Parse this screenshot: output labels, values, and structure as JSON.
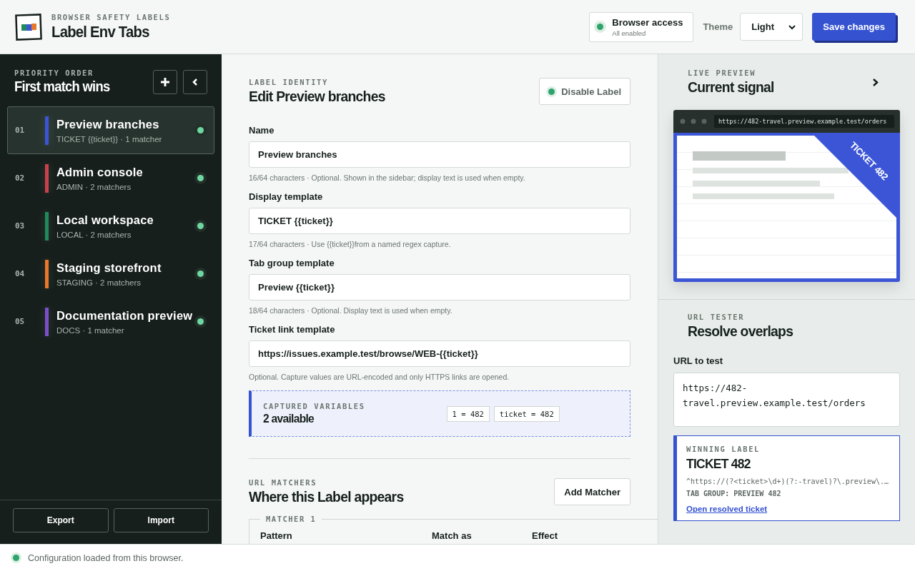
{
  "app": {
    "eyebrow": "BROWSER SAFETY LABELS",
    "title": "Label Env Tabs"
  },
  "access": {
    "label": "Browser access",
    "detail": "All enabled",
    "on": true
  },
  "theme": {
    "label": "Theme",
    "value": "Light"
  },
  "save_button": "Save changes",
  "sidebar": {
    "eyebrow": "PRIORITY ORDER",
    "title": "First match wins",
    "labels": [
      {
        "index": "01",
        "name": "Preview branches",
        "detail": "TICKET {{ticket}} · 1 matcher",
        "color": "#3b55d6",
        "selected": true,
        "enabled": true
      },
      {
        "index": "02",
        "name": "Admin console",
        "detail": "ADMIN · 2 matchers",
        "color": "#c8414b",
        "selected": false,
        "enabled": true
      },
      {
        "index": "03",
        "name": "Local workspace",
        "detail": "LOCAL · 2 matchers",
        "color": "#1f8a5b",
        "selected": false,
        "enabled": true
      },
      {
        "index": "04",
        "name": "Staging storefront",
        "detail": "STAGING · 2 matchers",
        "color": "#e8792a",
        "selected": false,
        "enabled": true
      },
      {
        "index": "05",
        "name": "Documentation preview",
        "detail": "DOCS · 1 matcher",
        "color": "#7a4fc9",
        "selected": false,
        "enabled": true
      }
    ],
    "footer_buttons": [
      "Export",
      "Import"
    ]
  },
  "editor": {
    "eyebrow": "LABEL IDENTITY",
    "title": "Edit Preview branches",
    "disable_button": "Disable Label",
    "fields": [
      {
        "label": "Name",
        "value": "Preview branches",
        "hint": "16/64 characters · Optional. Shown in the sidebar; display text is used when empty."
      },
      {
        "label": "Display template",
        "value": "TICKET {{ticket}}",
        "hint": "17/64 characters · Use {{ticket}}from a named regex capture."
      },
      {
        "label": "Tab group template",
        "value": "Preview {{ticket}}",
        "hint": "18/64 characters · Optional. Display text is used when empty."
      },
      {
        "label": "Ticket link template",
        "value": "https://issues.example.test/browse/WEB-{{ticket}}",
        "hint": "Optional. Capture values are URL-encoded and only HTTPS links are opened."
      }
    ],
    "captured": {
      "eyebrow": "CAPTURED VARIABLES",
      "title": "2 available",
      "chips": [
        "1 = 482",
        "ticket = 482"
      ]
    },
    "matchers": {
      "eyebrow": "URL MATCHERS",
      "title": "Where this Label appears",
      "add_button": "Add Matcher",
      "group": "MATCHER 1",
      "columns": [
        "Pattern",
        "Match as",
        "Effect"
      ]
    }
  },
  "preview": {
    "eyebrow": "LIVE PREVIEW",
    "title": "Current signal",
    "url": "https://482-travel.preview.example.test/orders",
    "ribbon": "TICKET 482"
  },
  "tester": {
    "eyebrow": "URL TESTER",
    "title": "Resolve overlaps",
    "field_label": "URL to test",
    "value": "https://482-travel.preview.example.test/orders",
    "winner": {
      "eyebrow": "WINNING LABEL",
      "title": "TICKET 482",
      "pattern": "^https://(?<ticket>\\d+)(?:-travel)?\\.preview\\.…",
      "tab_group": "TAB GROUP: PREVIEW 482",
      "link": "Open resolved ticket"
    }
  },
  "status": {
    "text": "Configuration loaded from this browser.",
    "ok": true
  }
}
